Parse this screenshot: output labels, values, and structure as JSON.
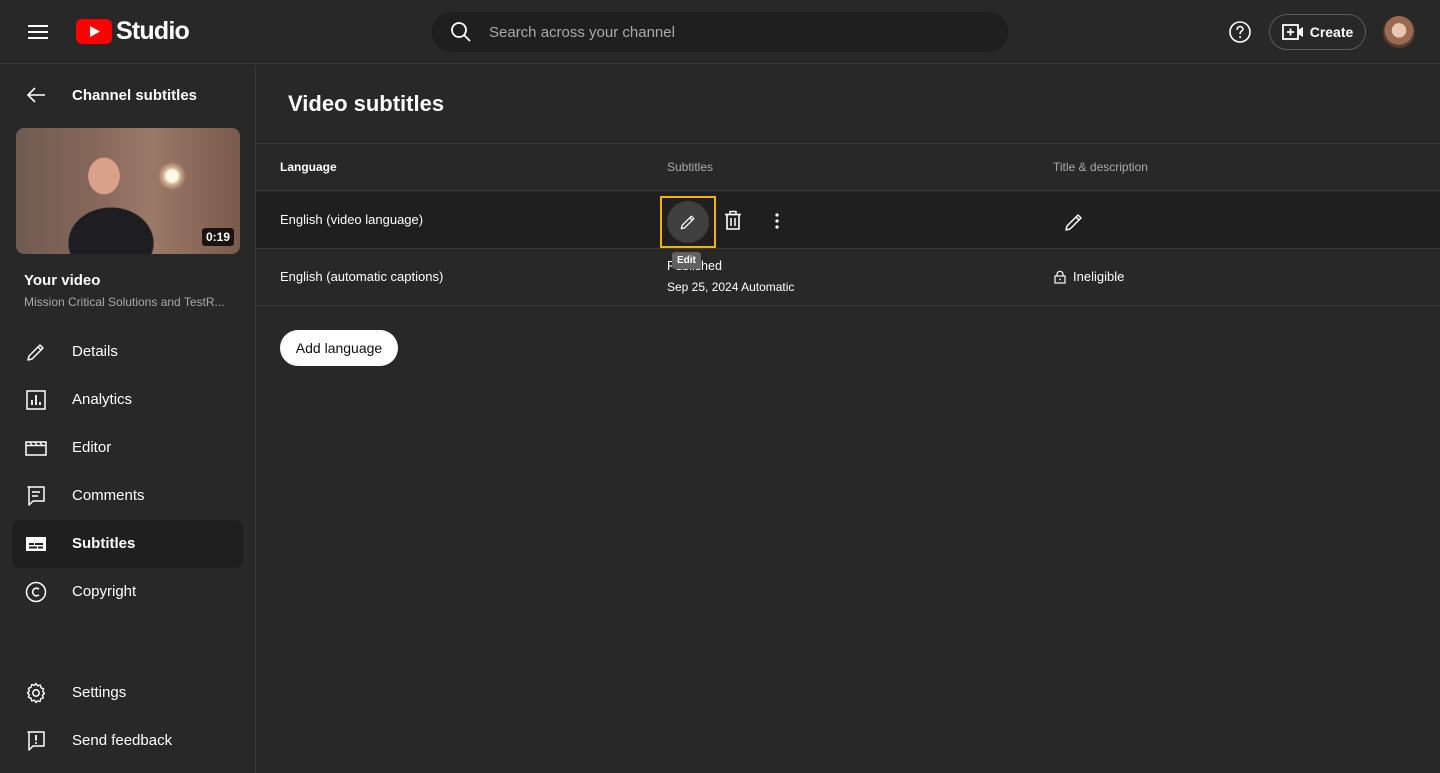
{
  "app": {
    "logo_text": "Studio",
    "brand_color": "#ff0000",
    "accent_highlight": "#f5b400"
  },
  "topbar": {
    "search_placeholder": "Search across your channel",
    "create_label": "Create"
  },
  "sidebar": {
    "back_title": "Channel subtitles",
    "video": {
      "duration": "0:19",
      "your_video_label": "Your video",
      "title": "Mission Critical Solutions and TestR..."
    },
    "nav": [
      {
        "label": "Details",
        "icon": "pencil-icon"
      },
      {
        "label": "Analytics",
        "icon": "analytics-icon"
      },
      {
        "label": "Editor",
        "icon": "clapper-icon"
      },
      {
        "label": "Comments",
        "icon": "comment-icon"
      },
      {
        "label": "Subtitles",
        "icon": "subtitles-icon",
        "active": true
      },
      {
        "label": "Copyright",
        "icon": "copyright-icon"
      }
    ],
    "bottom": [
      {
        "label": "Settings",
        "icon": "gear-icon"
      },
      {
        "label": "Send feedback",
        "icon": "feedback-icon"
      }
    ]
  },
  "main": {
    "page_title": "Video subtitles",
    "columns": {
      "language": "Language",
      "subtitles": "Subtitles",
      "title_description": "Title & description"
    },
    "rows": [
      {
        "language": "English (video language)",
        "tooltip": "Edit"
      },
      {
        "language": "English (automatic captions)",
        "status_line1": "Published",
        "status_line2": "Sep 25, 2024 Automatic",
        "title_status": "Ineligible"
      }
    ],
    "add_language_label": "Add language"
  }
}
